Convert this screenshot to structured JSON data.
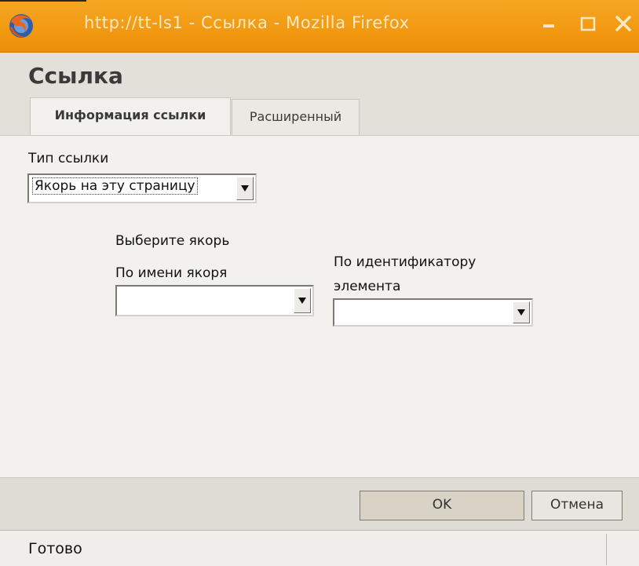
{
  "window": {
    "title": "http://tt-ls1 - Ссылка - Mozilla Firefox"
  },
  "dialog": {
    "title": "Ссылка",
    "tabs": [
      {
        "label": "Информация ссылки",
        "active": true
      },
      {
        "label": "Расширенный",
        "active": false
      }
    ],
    "link_type": {
      "label": "Тип ссылки",
      "selected": "Якорь на эту страницу"
    },
    "anchor_section": {
      "title": "Выберите якорь",
      "by_name_label": "По имени якоря",
      "by_name_selected": "",
      "by_id_label_line1": "По идентификатору",
      "by_id_label_line2": "элемента",
      "by_id_selected": ""
    },
    "buttons": {
      "ok": "OK",
      "cancel": "Отмена"
    }
  },
  "statusbar": {
    "text": "Готово"
  }
}
